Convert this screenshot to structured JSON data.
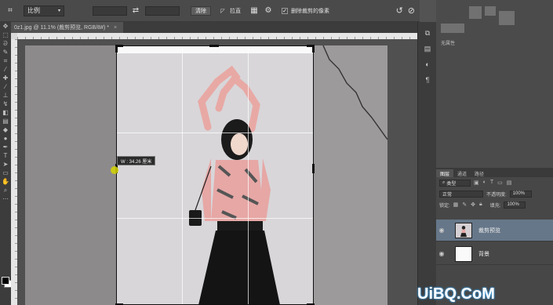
{
  "options_bar": {
    "preset": "比例",
    "clear_label": "清除",
    "straighten_label": "拉直",
    "delete_cropped_label": "删除裁剪的像素",
    "delete_cropped_checked": true,
    "icons": [
      "crop-tool-icon",
      "swap-icon",
      "grid-overlay-icon",
      "settings-gear-icon",
      "reset-icon",
      "cancel-icon"
    ]
  },
  "document_tab": {
    "title": "0z1.jpg @ 11.1% (裁剪预览, RGB/8#) *",
    "close_glyph": "×"
  },
  "crop": {
    "tooltip": "W : 34.26 厘米"
  },
  "right_panel": {
    "header": "无属性"
  },
  "layers_panel": {
    "tabs": [
      "图层",
      "通道",
      "路径"
    ],
    "active_tab": 0,
    "filter_label": "类型",
    "blend_mode": "正常",
    "opacity_label": "不透明度:",
    "opacity_value": "100%",
    "lock_label": "锁定:",
    "fill_label": "填充:",
    "fill_value": "100%",
    "layers": [
      {
        "name": "裁剪预览",
        "selected": true,
        "visible": true
      },
      {
        "name": "背景",
        "selected": false,
        "visible": true
      }
    ]
  },
  "watermark": "UiBQ.CoM",
  "colors": {
    "foreground": "#000000",
    "background": "#ffffff",
    "selected_layer": "#667789"
  }
}
